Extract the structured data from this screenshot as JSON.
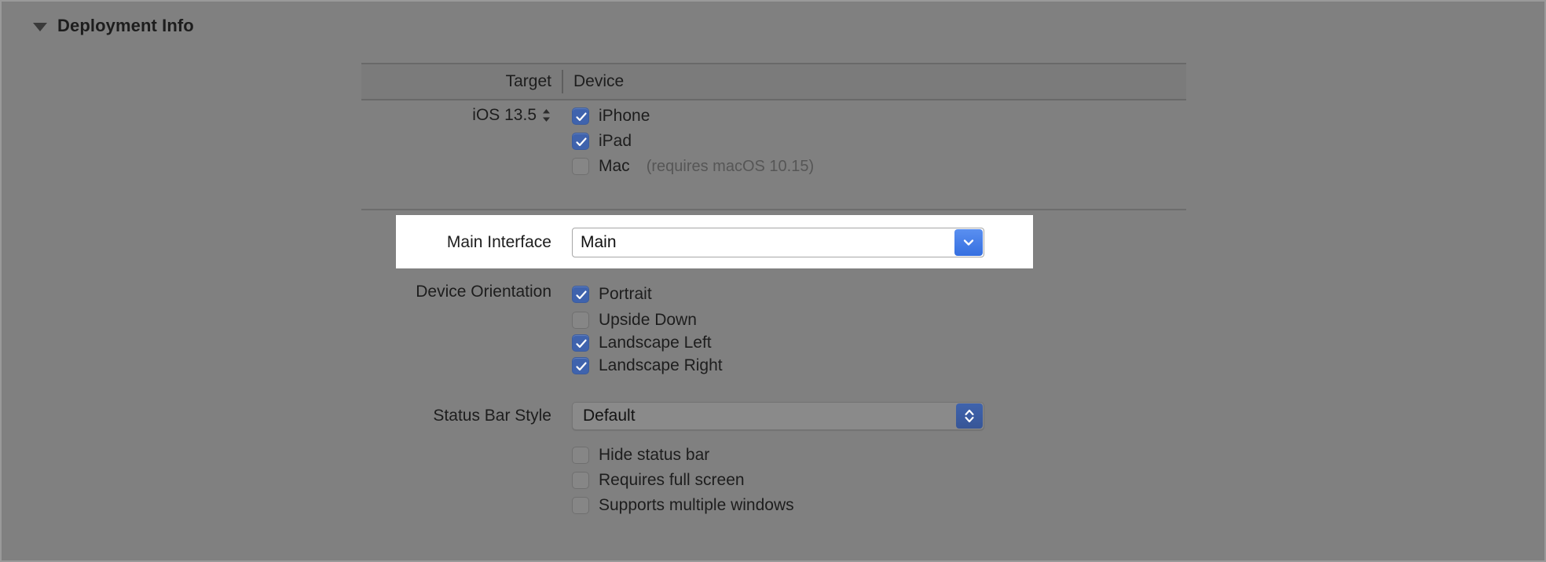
{
  "section": {
    "title": "Deployment Info",
    "disclosure_state": "expanded"
  },
  "table": {
    "columns": [
      "Target",
      "Device"
    ]
  },
  "deployment_target": {
    "label": "Target",
    "value": "iOS 13.5",
    "stepper_icon": "up-down-chevron-icon"
  },
  "devices": [
    {
      "label": "iPhone",
      "checked": true,
      "note": ""
    },
    {
      "label": "iPad",
      "checked": true,
      "note": ""
    },
    {
      "label": "Mac",
      "checked": false,
      "note": "(requires macOS 10.15)"
    }
  ],
  "main_interface": {
    "label": "Main Interface",
    "value": "Main",
    "placeholder": "",
    "dropdown_icon": "chevron-down-icon",
    "highlighted": true,
    "accent_color": "#3d7bea"
  },
  "device_orientation": {
    "label": "Device Orientation",
    "options": [
      {
        "label": "Portrait",
        "checked": true
      },
      {
        "label": "Upside Down",
        "checked": false
      },
      {
        "label": "Landscape Left",
        "checked": true
      },
      {
        "label": "Landscape Right",
        "checked": true
      }
    ]
  },
  "status_bar_style": {
    "label": "Status Bar Style",
    "value": "Default",
    "stepper_icon": "up-down-chevron-icon",
    "options": [
      {
        "label": "Hide status bar",
        "checked": false
      },
      {
        "label": "Requires full screen",
        "checked": false
      },
      {
        "label": "Supports multiple windows",
        "checked": false
      }
    ]
  },
  "colors": {
    "background": "#808080",
    "checkbox_on": "#3f63ad",
    "combo_button": "#3d7bea",
    "text": "#1d1d1d",
    "secondary_text": "#565656"
  }
}
